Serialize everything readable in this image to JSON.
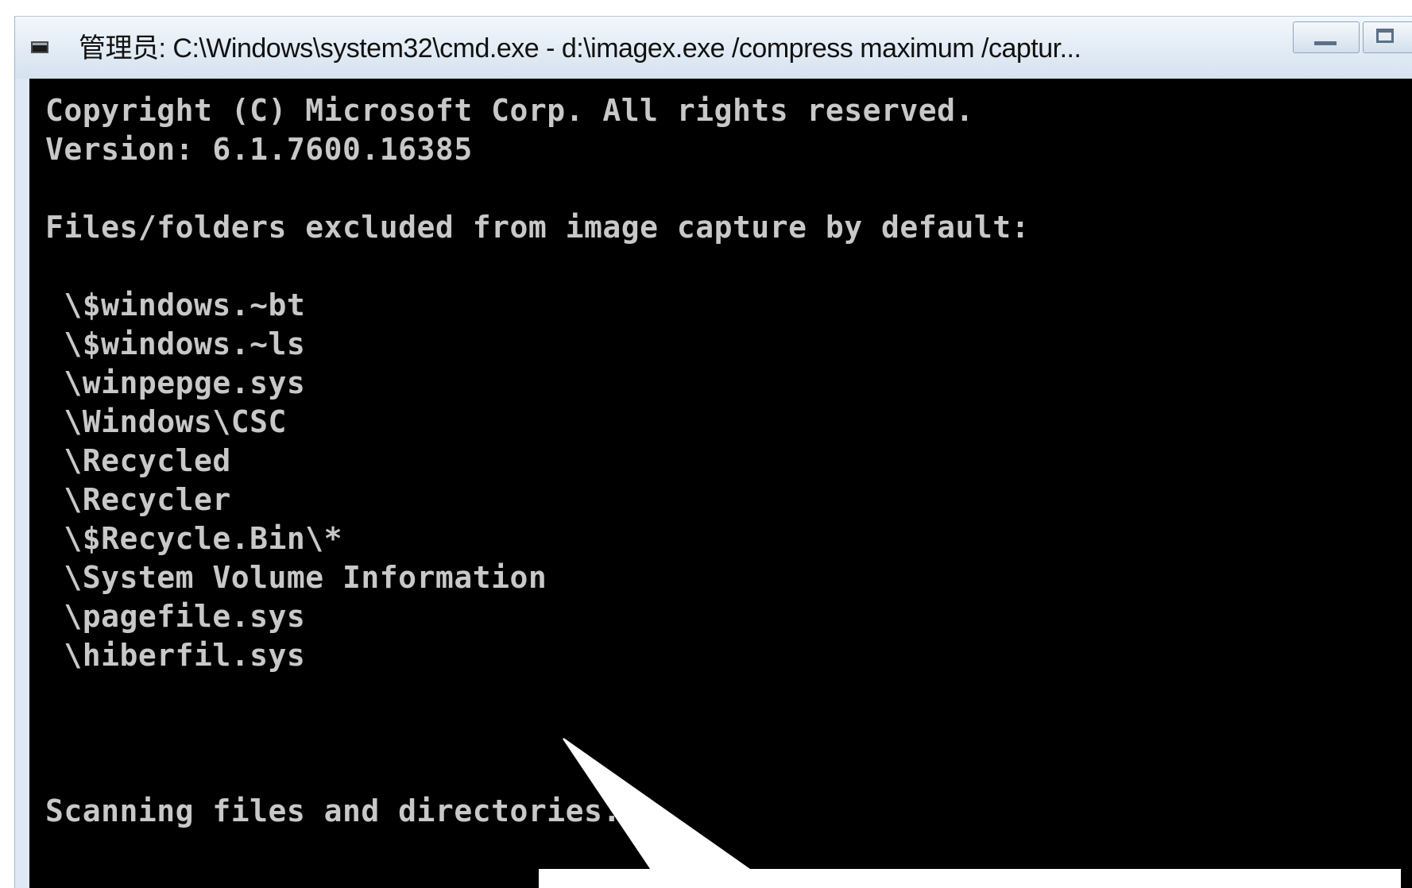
{
  "window": {
    "title": "管理员: C:\\Windows\\system32\\cmd.exe - d:\\imagex.exe  /compress maximum /captur..."
  },
  "console": {
    "lines": [
      "Copyright (C) Microsoft Corp. All rights reserved.",
      "Version: 6.1.7600.16385",
      "",
      "Files/folders excluded from image capture by default:",
      "",
      " \\$windows.~bt",
      " \\$windows.~ls",
      " \\winpepge.sys",
      " \\Windows\\CSC",
      " \\Recycled",
      " \\Recycler",
      " \\$Recycle.Bin\\*",
      " \\System Volume Information",
      " \\pagefile.sys",
      " \\hiberfil.sys",
      "",
      "",
      "",
      "Scanning files and directories..."
    ]
  },
  "colors": {
    "console_background": "#000000",
    "console_text": "#c8c8c8",
    "titlebar": "#dfe9f5"
  },
  "icons": {
    "app": "console-icon",
    "minimize": "minimize-icon",
    "maximize": "maximize-icon"
  }
}
